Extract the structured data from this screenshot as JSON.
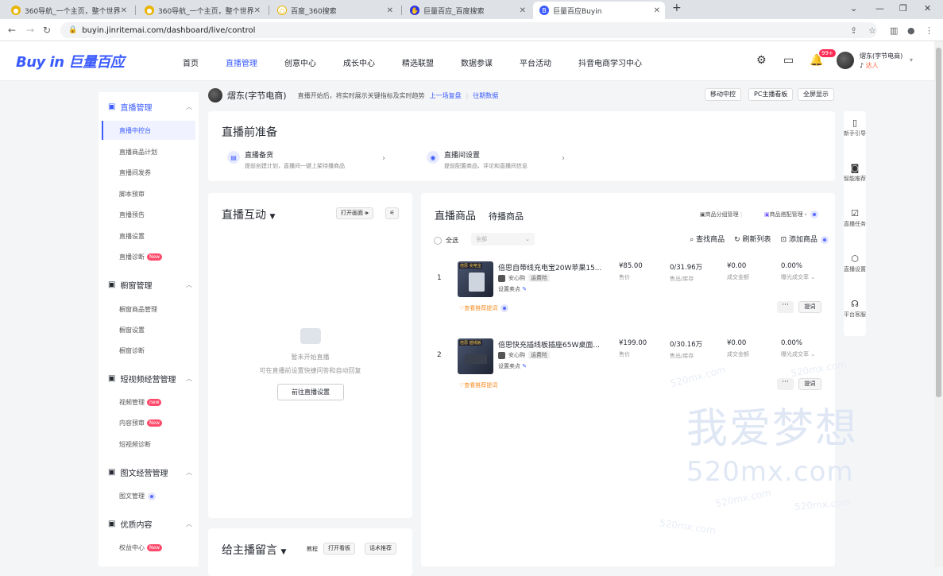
{
  "browser": {
    "tabs": [
      {
        "title": "360导航_一个主页，整个世界"
      },
      {
        "title": "360导航_一个主页，整个世界"
      },
      {
        "title": "百度_360搜索"
      },
      {
        "title": "巨量百应_百度搜索"
      },
      {
        "title": "巨量百应Buyin"
      }
    ],
    "url": "buyin.jinritemai.com/dashboard/live/control"
  },
  "app": {
    "logo": "Buy in 巨量百应",
    "nav": [
      "首页",
      "直播管理",
      "创意中心",
      "成长中心",
      "精选联盟",
      "数据参谋",
      "平台活动",
      "抖音电商学习中心"
    ],
    "notif_badge": "99+",
    "user_name": "熠东(字节电商)",
    "user_role": "达人"
  },
  "sidebar": {
    "groups": [
      {
        "label": "直播管理",
        "items": [
          "直播中控台",
          "直播商品计划",
          "直播间发券",
          "脚本预审",
          "直播预告",
          "直播设置",
          "直播诊断"
        ]
      },
      {
        "label": "橱窗管理",
        "items": [
          "橱窗商品管理",
          "橱窗设置",
          "橱窗诊断"
        ]
      },
      {
        "label": "短视频经营管理",
        "items": [
          "视频管理",
          "内容预审",
          "短视频诊断"
        ]
      },
      {
        "label": "图文经营管理",
        "items": [
          "图文管理"
        ]
      },
      {
        "label": "优质内容",
        "items": [
          "权益中心"
        ]
      }
    ],
    "new_tag": "New",
    "new_tag_lower": "new"
  },
  "anchor": {
    "name": "熠东(字节电商)",
    "tip": "直播开始后，将实时展示关键指标及实时趋势",
    "link1": "上一场复盘",
    "link2": "往期数据",
    "buttons": [
      "移动中控",
      "PC主播看板",
      "全屏显示"
    ]
  },
  "prep": {
    "title": "直播前准备",
    "items": [
      {
        "title": "直播备货",
        "desc": "提前创建计划，直播间一键上架待播商品"
      },
      {
        "title": "直播间设置",
        "desc": "提前配置商品、评论和直播间信息"
      }
    ]
  },
  "interact": {
    "title": "直播互动",
    "open_btn": "打开画面",
    "empty_title": "暂未开始直播",
    "empty_desc": "可在直播前设置快捷问答和自动回复",
    "go_btn": "前往直播设置"
  },
  "msg": {
    "title": "给主播留言",
    "tutorial": "教程",
    "open_board": "打开看板",
    "script_rec": "话术推荐"
  },
  "products": {
    "tab_active": "直播商品",
    "tab_pending": "待播商品",
    "tool1": "商品分组管理",
    "tool2": "商品搭配管理",
    "select_all": "全选",
    "filter": "全部",
    "find": "查找商品",
    "refresh": "刷新列表",
    "add": "添加商品",
    "rows": [
      {
        "index": "1",
        "title": "倍思自带线充电宝20W苹果15...",
        "tag1": "安心购",
        "tag2": "运费险",
        "selling": "设置卖点",
        "price": "¥85.00",
        "price_label": "售价",
        "stock": "0/31.96万",
        "stock_label": "售出/库存",
        "amount": "¥0.00",
        "amount_label": "成交金额",
        "rate": "0.00%",
        "rate_label": "曝光成交率",
        "rec": "查看推荐提词",
        "img_label": "倍思 充电宝",
        "more": "···",
        "speak": "提词"
      },
      {
        "index": "2",
        "title": "倍思快充插线板插座65W桌面...",
        "tag1": "安心购",
        "tag2": "运费险",
        "selling": "设置卖点",
        "price": "¥199.00",
        "price_label": "售价",
        "stock": "0/30.16万",
        "stock_label": "售出/库存",
        "amount": "¥0.00",
        "amount_label": "成交金额",
        "rate": "0.00%",
        "rate_label": "曝光成交率",
        "rec": "查看推荐提词",
        "img_label": "倍思 插线板",
        "more": "···",
        "speak": "提词"
      }
    ]
  },
  "right_tools": [
    "新手引导",
    "智能推荐",
    "直播任务",
    "直播设置",
    "平台客服"
  ],
  "watermark": {
    "main": "我爱梦想",
    "site": "520mx.com"
  }
}
